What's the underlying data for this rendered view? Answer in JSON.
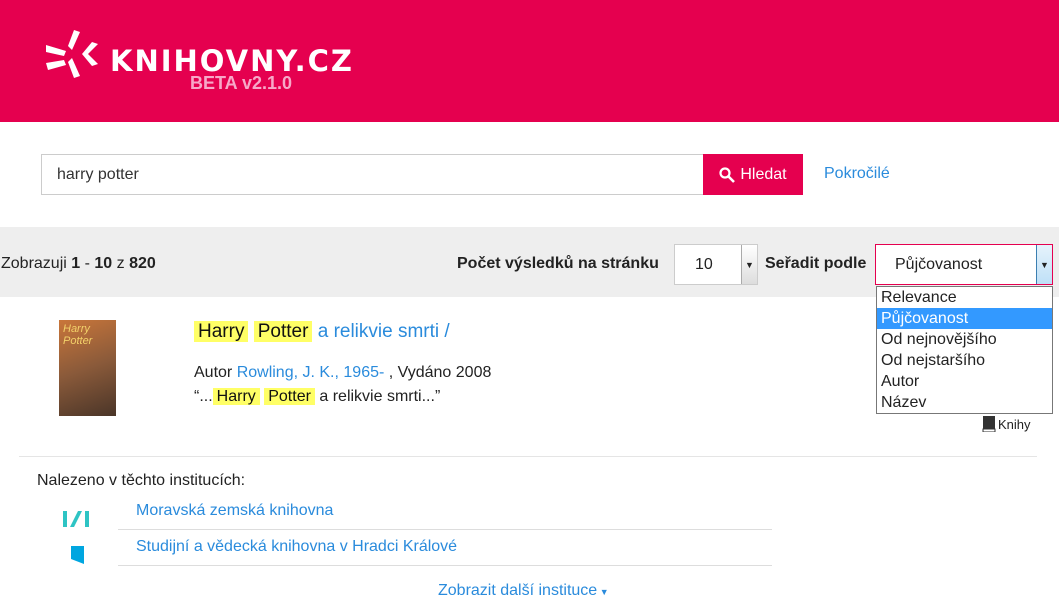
{
  "header": {
    "logo_text": "KNIHOVNY.CZ",
    "version": "BETA v2.1.0",
    "color": "#e5004f"
  },
  "search": {
    "value": "harry potter",
    "button": "Hledat",
    "advanced": "Pokročilé"
  },
  "toolbar": {
    "count_prefix": "Zobrazuji ",
    "from": "1",
    "sep": " - ",
    "to": "10",
    "of": " z ",
    "total": "820",
    "per_page_label": "Počet výsledků na stránku",
    "per_page": "10",
    "sort_label": "Seřadit podle",
    "sort_value": "Půjčovanost",
    "sort_options": [
      "Relevance",
      "Půjčovanost",
      "Od nejnovějšího",
      "Od nejstaršího",
      "Autor",
      "Název"
    ]
  },
  "result": {
    "cover_text": "Harry Potter",
    "title_hl1": "Harry",
    "title_hl2": "Potter",
    "title_rest": "a relikvie smrti /",
    "author_label": "Autor ",
    "author": "Rowling, J. K., 1965-",
    "published": " , Vydáno 2008",
    "snippet_start": "“...",
    "snippet_hl1": "Harry",
    "snippet_hl2": "Potter",
    "snippet_end": " a relikvie smrti...”",
    "type": "Knihy"
  },
  "institutions": {
    "label": "Nalezeno v těchto institucích:",
    "items": [
      "Moravská zemská knihovna",
      "Studijní a vědecká knihovna v Hradci Králové"
    ],
    "more": "Zobrazit další instituce"
  }
}
